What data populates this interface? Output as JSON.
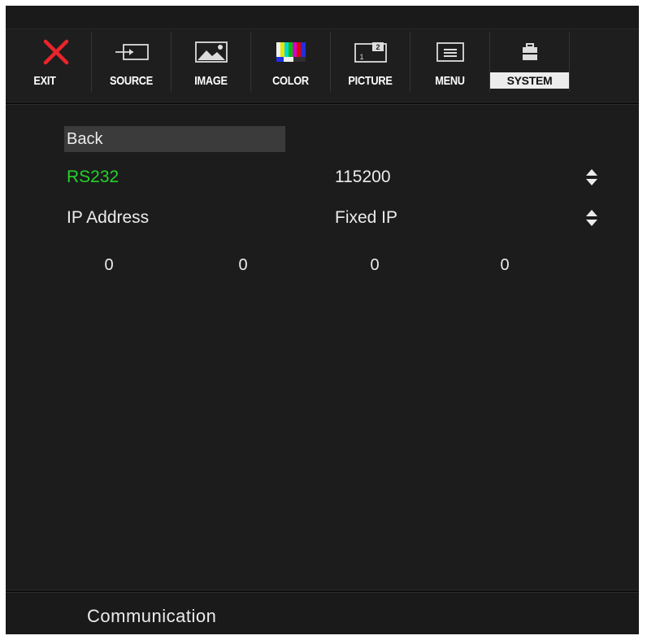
{
  "menu": {
    "tabs": [
      {
        "label": "EXIT",
        "icon": "close-icon"
      },
      {
        "label": "SOURCE",
        "icon": "source-icon"
      },
      {
        "label": "IMAGE",
        "icon": "image-icon"
      },
      {
        "label": "COLOR",
        "icon": "color-bars-icon"
      },
      {
        "label": "PICTURE",
        "icon": "picture-in-picture-icon"
      },
      {
        "label": "MENU",
        "icon": "menu-icon"
      },
      {
        "label": "SYSTEM",
        "icon": "toolbox-icon",
        "active": true
      }
    ]
  },
  "panel": {
    "back_label": "Back",
    "rows": [
      {
        "label": "RS232",
        "value": "115200",
        "highlighted": true
      },
      {
        "label": "IP Address",
        "value": "Fixed IP",
        "highlighted": false
      }
    ],
    "ip_segments": [
      "0",
      "0",
      "0",
      "0"
    ]
  },
  "footer": {
    "status": "Communication"
  },
  "colors": {
    "background": "#1c1c1c",
    "text": "#ececec",
    "highlight": "#22d42a",
    "exit_icon": "#e8252b",
    "active_tab_bg": "#ececec"
  }
}
